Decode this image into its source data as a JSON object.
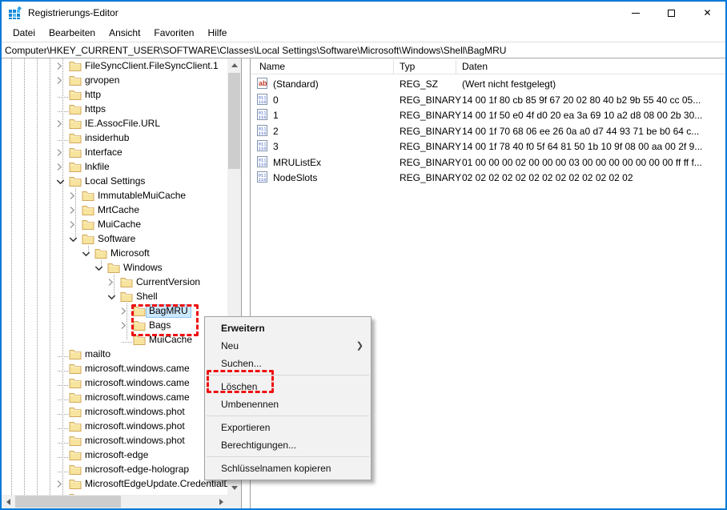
{
  "window": {
    "title": "Registrierungs-Editor",
    "accent_border_color": "#0079d7"
  },
  "menubar": {
    "items": [
      "Datei",
      "Bearbeiten",
      "Ansicht",
      "Favoriten",
      "Hilfe"
    ]
  },
  "addressbar": {
    "value": "Computer\\HKEY_CURRENT_USER\\SOFTWARE\\Classes\\Local Settings\\Software\\Microsoft\\Windows\\Shell\\BagMRU"
  },
  "tree": {
    "items": [
      {
        "label": "FileSyncClient.FileSyncClient.1",
        "level": 0,
        "state": "collapsed"
      },
      {
        "label": "grvopen",
        "level": 0,
        "state": "collapsed"
      },
      {
        "label": "http",
        "level": 0,
        "state": "leaf"
      },
      {
        "label": "https",
        "level": 0,
        "state": "leaf"
      },
      {
        "label": "IE.AssocFile.URL",
        "level": 0,
        "state": "collapsed"
      },
      {
        "label": "insiderhub",
        "level": 0,
        "state": "leaf"
      },
      {
        "label": "Interface",
        "level": 0,
        "state": "collapsed"
      },
      {
        "label": "lnkfile",
        "level": 0,
        "state": "collapsed"
      },
      {
        "label": "Local Settings",
        "level": 0,
        "state": "expanded"
      },
      {
        "label": "ImmutableMuiCache",
        "level": 1,
        "state": "collapsed"
      },
      {
        "label": "MrtCache",
        "level": 1,
        "state": "collapsed"
      },
      {
        "label": "MuiCache",
        "level": 1,
        "state": "collapsed"
      },
      {
        "label": "Software",
        "level": 1,
        "state": "expanded"
      },
      {
        "label": "Microsoft",
        "level": 2,
        "state": "expanded"
      },
      {
        "label": "Windows",
        "level": 3,
        "state": "expanded"
      },
      {
        "label": "CurrentVersion",
        "level": 4,
        "state": "collapsed"
      },
      {
        "label": "Shell",
        "level": 4,
        "state": "expanded"
      },
      {
        "label": "BagMRU",
        "level": 5,
        "state": "collapsed",
        "selected": true
      },
      {
        "label": "Bags",
        "level": 5,
        "state": "collapsed"
      },
      {
        "label": "MuiCache",
        "level": 5,
        "state": "leaf"
      },
      {
        "label": "mailto",
        "level": 0,
        "state": "leaf"
      },
      {
        "label": "microsoft.windows.came",
        "level": 0,
        "state": "leaf"
      },
      {
        "label": "microsoft.windows.came",
        "level": 0,
        "state": "leaf"
      },
      {
        "label": "microsoft.windows.came",
        "level": 0,
        "state": "leaf"
      },
      {
        "label": "microsoft.windows.phot",
        "level": 0,
        "state": "leaf"
      },
      {
        "label": "microsoft.windows.phot",
        "level": 0,
        "state": "leaf"
      },
      {
        "label": "microsoft.windows.phot",
        "level": 0,
        "state": "leaf"
      },
      {
        "label": "microsoft-edge",
        "level": 0,
        "state": "leaf"
      },
      {
        "label": "microsoft-edge-holograp",
        "level": 0,
        "state": "leaf"
      },
      {
        "label": "MicrosoftEdgeUpdate.CredentialDi",
        "level": 0,
        "state": "collapsed"
      },
      {
        "label": "",
        "level": 0,
        "state": "leaf"
      }
    ],
    "selection_color": "#cce8ff"
  },
  "list": {
    "columns": [
      "Name",
      "Typ",
      "Daten"
    ],
    "rows": [
      {
        "icon": "string-value-icon",
        "name": "(Standard)",
        "type": "REG_SZ",
        "data": "(Wert nicht festgelegt)"
      },
      {
        "icon": "binary-value-icon",
        "name": "0",
        "type": "REG_BINARY",
        "data": "14 00 1f 80 cb 85 9f 67 20 02 80 40 b2 9b 55 40 cc 05..."
      },
      {
        "icon": "binary-value-icon",
        "name": "1",
        "type": "REG_BINARY",
        "data": "14 00 1f 50 e0 4f d0 20 ea 3a 69 10 a2 d8 08 00 2b 30..."
      },
      {
        "icon": "binary-value-icon",
        "name": "2",
        "type": "REG_BINARY",
        "data": "14 00 1f 70 68 06 ee 26 0a a0 d7 44 93 71 be b0 64 c..."
      },
      {
        "icon": "binary-value-icon",
        "name": "3",
        "type": "REG_BINARY",
        "data": "14 00 1f 78 40 f0 5f 64 81 50 1b 10 9f 08 00 aa 00 2f 9..."
      },
      {
        "icon": "binary-value-icon",
        "name": "MRUListEx",
        "type": "REG_BINARY",
        "data": "01 00 00 00 02 00 00 00 03 00 00 00 00 00 00 00 ff ff f..."
      },
      {
        "icon": "binary-value-icon",
        "name": "NodeSlots",
        "type": "REG_BINARY",
        "data": "02 02 02 02 02 02 02 02 02 02 02 02 02"
      }
    ]
  },
  "context_menu": {
    "items": [
      {
        "label": "Erweitern",
        "bold": true
      },
      {
        "label": "Neu",
        "submenu": true
      },
      {
        "label": "Suchen...",
        "separator_after": true
      },
      {
        "label": "Löschen",
        "annotated": true
      },
      {
        "label": "Umbenennen",
        "separator_after": true
      },
      {
        "label": "Exportieren"
      },
      {
        "label": "Berechtigungen...",
        "separator_after": true
      },
      {
        "label": "Schlüsselnamen kopieren"
      }
    ]
  },
  "annotations": {
    "color": "#ee1111",
    "targets": [
      "BagMRU and Bags tree keys",
      "Löschen menu item"
    ]
  }
}
